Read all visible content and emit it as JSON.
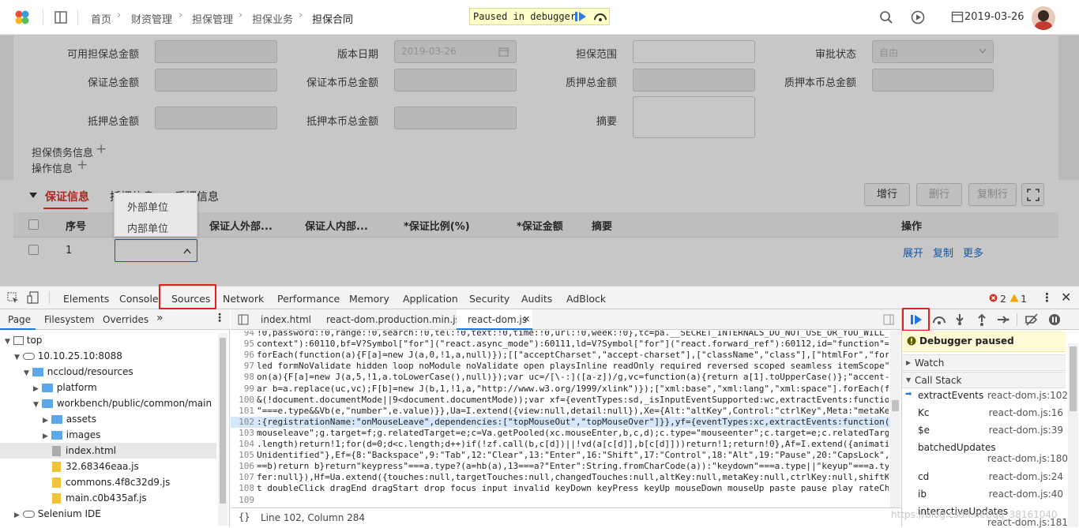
{
  "topbar": {
    "breadcrumb": [
      "首页",
      "财资管理",
      "担保管理",
      "担保业务",
      "担保合同"
    ],
    "debugger_banner": "Paused in debugger",
    "date": "2019-03-26"
  },
  "form": {
    "labels": [
      "可用担保总金额",
      "版本日期",
      "担保范围",
      "审批状态",
      "保证总金额",
      "保证本币总金额",
      "质押总金额",
      "质押本币总金额",
      "抵押总金额",
      "抵押本币总金额",
      "摘要"
    ],
    "version_date": "2019-03-26",
    "approval_value": "自由",
    "section_debt": "担保债务信息",
    "section_ops": "操作信息"
  },
  "grid": {
    "tabs": [
      "保证信息",
      "抵押信息",
      "质押信息"
    ],
    "buttons": [
      "增行",
      "删行",
      "复制行"
    ],
    "columns": [
      "序号",
      "保证人外部...",
      "保证人内部...",
      "*保证比例(%)",
      "*保证金额",
      "摘要",
      "操作"
    ],
    "row_index": "1",
    "dropdown": [
      "外部单位",
      "内部单位"
    ],
    "row_links": [
      "展开",
      "复制",
      "更多"
    ]
  },
  "devtools": {
    "tabs": [
      "Elements",
      "Console",
      "Sources",
      "Network",
      "Performance",
      "Memory",
      "Application",
      "Security",
      "Audits",
      "AdBlock"
    ],
    "errors": "2",
    "warnings": "1",
    "nav_tabs": [
      "Page",
      "Filesystem",
      "Overrides"
    ],
    "tree": [
      "top",
      "10.10.25.10:8088",
      "nccloud/resources",
      "platform",
      "workbench/public/common/main",
      "assets",
      "images",
      "index.html",
      "32.68346eaa.js",
      "commons.4f8c32d9.js",
      "main.c0b435af.js",
      "Selenium IDE"
    ],
    "editor_tabs": [
      "index.html",
      "react-dom.production.min.js",
      "react-dom.js"
    ],
    "code_lines": [
      {
        "n": "94",
        "t": "!0,password:!0,range:!0,search:!0,tel:!0,text:!0,time:!0,url:!0,week:!0},tc=pa.__SECRET_INTERNALS_DO_NOT_USE_OR_YOU_WILL_"
      },
      {
        "n": "95",
        "t": "context\"):60110,bf=V?Symbol[\"for\"](\"react.async_mode\"):60111,ld=V?Symbol[\"for\"](\"react.forward_ref\"):60112,id=\"function\"=="
      },
      {
        "n": "96",
        "t": "forEach(function(a){F[a]=new J(a,0,!1,a,null)});[[\"acceptCharset\",\"accept-charset\"],[\"className\",\"class\"],[\"htmlFor\",\"for"
      },
      {
        "n": "97",
        "t": "led formNoValidate hidden loop noModule noValidate open playsInline readOnly required reversed scoped seamless itemScope\""
      },
      {
        "n": "98",
        "t": "on(a){F[a]=new J(a,5,!1,a.toLowerCase(),null)});var uc=/[\\-:]([a-z])/g,vc=function(a){return a[1].toUpperCase()};\"accent-h"
      },
      {
        "n": "99",
        "t": "ar b=a.replace(uc,vc);F[b]=new J(b,1,!1,a,\"http://www.w3.org/1999/xlink\")});[\"xml:base\",\"xml:lang\",\"xml:space\"].forEach(fu"
      },
      {
        "n": "100",
        "t": "&(!document.documentMode||9<document.documentMode));var xf={eventTypes:sd,_isInputEventSupported:wc,extractEvents:function"
      },
      {
        "n": "101",
        "t": "\"===e.type&&Vb(e,\"number\",e.value)}},Ua=I.extend({view:null,detail:null}),Xe={Alt:\"altKey\",Control:\"ctrlKey\",Meta:\"metaKey"
      },
      {
        "n": "102",
        "t": ":{registrationName:\"onMouseLeave\",dependencies:[\"topMouseOut\",\"topMouseOver\"]}},yf={eventTypes:xc,extractEvents:function(a"
      },
      {
        "n": "103",
        "t": "mouseleave\";g.target=f;g.relatedTarget=e;c=Va.getPooled(xc.mouseEnter,b,c,d);c.type=\"mouseenter\";c.target=e;c.relatedTarge"
      },
      {
        "n": "104",
        "t": ".length)return!1;for(d=0;d<c.length;d++)if(!zf.call(b,c[d])||!vd(a[c[d]],b[c[d]]))return!1;return!0},Af=I.extend({animatio"
      },
      {
        "n": "105",
        "t": "Unidentified\"},Ef={8:\"Backspace\",9:\"Tab\",12:\"Clear\",13:\"Enter\",16:\"Shift\",17:\"Control\",18:\"Alt\",19:\"Pause\",20:\"CapsLock\",2"
      },
      {
        "n": "106",
        "t": "==b)return b}return\"keypress\"===a.type?(a=hb(a),13===a?\"Enter\":String.fromCharCode(a)):\"keydown\"===a.type||\"keyup\"===a.typ"
      },
      {
        "n": "107",
        "t": "fer:null}),Hf=Ua.extend({touches:null,targetTouches:null,changedTouches:null,altKey:null,metaKey:null,ctrlKey:null,shiftKe"
      },
      {
        "n": "108",
        "t": "t doubleClick dragEnd dragStart drop focus input invalid keyDown keyPress keyUp mouseDown mouseUp paste pause play rateCha"
      },
      {
        "n": "109",
        "t": ""
      }
    ],
    "status": "Line 102, Column 284",
    "paused": "Debugger paused",
    "watch": "Watch",
    "callstack": "Call Stack",
    "stack": [
      [
        "extractEvents",
        "react-dom.js:102"
      ],
      [
        "Kc",
        "react-dom.js:16"
      ],
      [
        "$e",
        "react-dom.js:39"
      ],
      [
        "batchedUpdates",
        "react-dom.js:180"
      ],
      [
        "cd",
        "react-dom.js:24"
      ],
      [
        "ib",
        "react-dom.js:40"
      ],
      [
        "interactiveUpdates",
        "react-dom.js:181"
      ]
    ],
    "watermark": "https://blog.csdn.net/qq_38161040"
  },
  "colors": {
    "accent": "#d9342b",
    "link": "#1a6fd1",
    "highlight": "#d6e6fb"
  }
}
